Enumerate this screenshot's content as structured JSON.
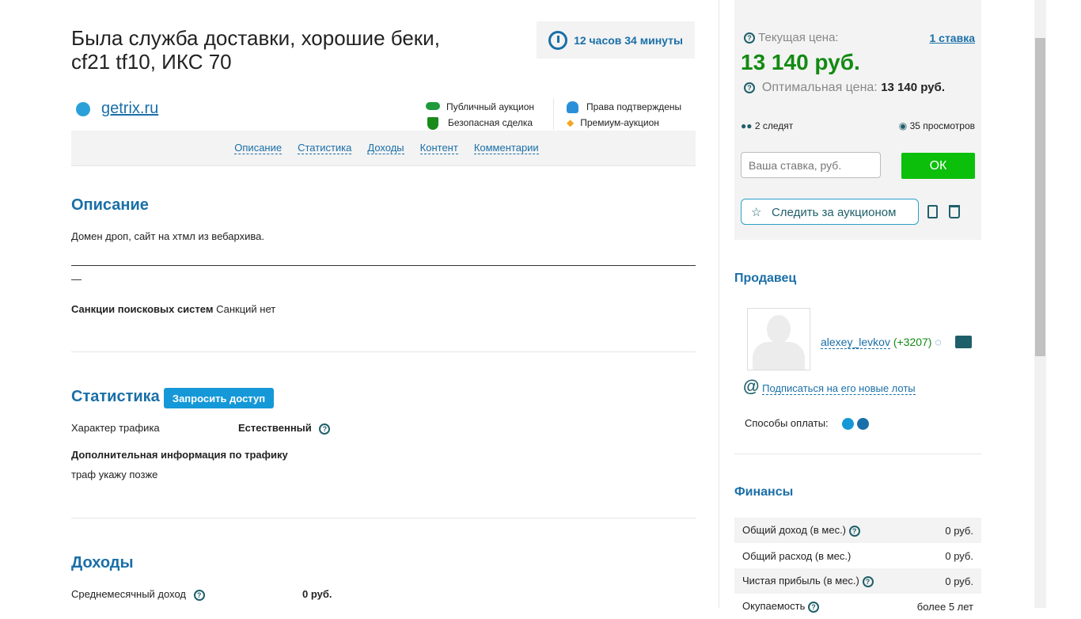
{
  "lot": {
    "title_line1": "Была служба доставки, хорошие беки,",
    "title_line2": "cf21 tf10, ИКС 70",
    "timer": "12 часов 34 минуты",
    "domain": "getrix.ru",
    "badges": [
      "Публичный аукцион",
      "Безопасная сделка",
      "Права подтверждены",
      "Премиум-аукцион"
    ]
  },
  "nav": [
    "Описание",
    "Статистика",
    "Доходы",
    "Контент",
    "Комментарии"
  ],
  "description": {
    "heading": "Описание",
    "text": "Домен дроп, сайт на хтмл из вебархива.",
    "dash_tail": "—",
    "sanctions_label": "Санкции поисковых систем",
    "sanctions_value": "Санкций нет"
  },
  "stats": {
    "heading": "Статистика",
    "request_button": "Запросить доступ",
    "traffic_label": "Характер трафика",
    "traffic_value": "Естественный",
    "extra_label": "Дополнительная информация по трафику",
    "extra_value": "траф укажу позже"
  },
  "income": {
    "heading": "Доходы",
    "avg_label": "Среднемесячный доход",
    "avg_value": "0 руб."
  },
  "bid": {
    "current_label": "Текущая цена:",
    "bids_link": "1 ставка",
    "current_price": "13 140 руб.",
    "optimal_label": "Оптимальная цена:",
    "optimal_price": "13 140 руб.",
    "watchers": "2 следят",
    "views": "35 просмотров",
    "input_placeholder": "Ваша ставка, руб.",
    "ok": "ОК",
    "watch_button": "Следить за аукционом"
  },
  "seller": {
    "heading": "Продавец",
    "name": "alexey_levkov",
    "rating": "(+3207)",
    "subscribe": "Подписаться на его новые лоты",
    "payment_label": "Способы оплаты:"
  },
  "finance": {
    "heading": "Финансы",
    "rows": [
      {
        "label": "Общий доход (в мес.)",
        "value": "0 руб.",
        "help": true
      },
      {
        "label": "Общий расход (в мес.)",
        "value": "0 руб.",
        "help": false
      },
      {
        "label": "Чистая прибыль (в мес.)",
        "value": "0 руб.",
        "help": true
      },
      {
        "label": "Окупаемость",
        "value": "более 5 лет",
        "help": true
      }
    ]
  },
  "colors": {
    "accent": "#1a6fa8",
    "price_green": "#138a13",
    "ok_green": "#0bbf0b",
    "request_blue": "#1598d8"
  }
}
